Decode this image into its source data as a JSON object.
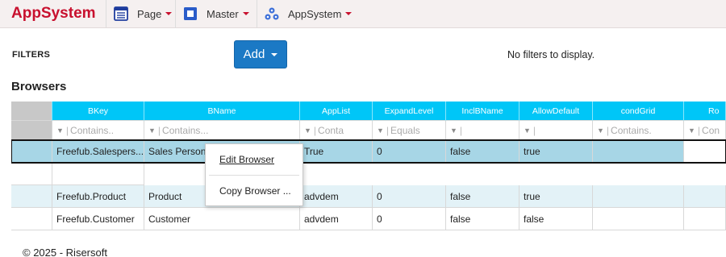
{
  "app": {
    "brand": "AppSystem"
  },
  "nav": [
    {
      "label": "Page",
      "icon": "grid-icon"
    },
    {
      "label": "Master",
      "icon": "square-icon"
    },
    {
      "label": "AppSystem",
      "icon": "cluster-icon"
    }
  ],
  "colors": {
    "brand": "#c8102e",
    "header": "#00c6f7",
    "button": "#1b79c5"
  },
  "filters": {
    "label": "FILTERS",
    "add_label": "Add",
    "empty_text": "No filters to display."
  },
  "section": {
    "title": "Browsers"
  },
  "grid": {
    "columns": [
      "BKey",
      "BName",
      "AppList",
      "ExpandLevel",
      "InclBName",
      "AllowDefault",
      "condGrid",
      "Ro"
    ],
    "filters": [
      "Contains..",
      "Contains...",
      "Conta",
      "Equals",
      "",
      "",
      "Contains.",
      "Con"
    ],
    "rows": [
      [
        "Freefub.Salespers...",
        "Sales Person",
        "True",
        "0",
        "false",
        "true",
        ""
      ],
      [
        "Freefub.Product",
        "Product",
        "advdem",
        "0",
        "false",
        "true",
        ""
      ],
      [
        "Freefub.Customer",
        "Customer",
        "advdem",
        "0",
        "false",
        "false",
        ""
      ]
    ]
  },
  "context_menu": {
    "items": [
      "Edit Browser",
      "Copy Browser ..."
    ]
  },
  "footer": {
    "text": "© 2025 - Risersoft"
  }
}
